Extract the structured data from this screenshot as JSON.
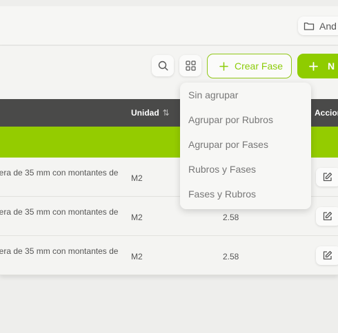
{
  "header": {
    "folder_label": "And"
  },
  "toolbar": {
    "create_phase_label": "Crear Fase",
    "new_label": "N"
  },
  "table": {
    "col_unidad": "Unidad",
    "sort_glyph": "⇅",
    "col_acciones": "Accion",
    "rows": [
      {
        "description": "lera de 35 mm con montantes de",
        "unit": "M2",
        "qty": ""
      },
      {
        "description": "lera de 35 mm con montantes de",
        "unit": "M2",
        "qty": "2.58"
      },
      {
        "description": "lera de 35 mm con montantes de",
        "unit": "M2",
        "qty": "2.58"
      }
    ]
  },
  "group_menu": {
    "options": [
      "Sin agrupar",
      "Agrupar por Rubros",
      "Agrupar por Fases",
      "Rubros y Fases",
      "Fases y Rubros"
    ]
  },
  "colors": {
    "accent": "#8fcc00",
    "header_bg": "#4a4a49"
  }
}
